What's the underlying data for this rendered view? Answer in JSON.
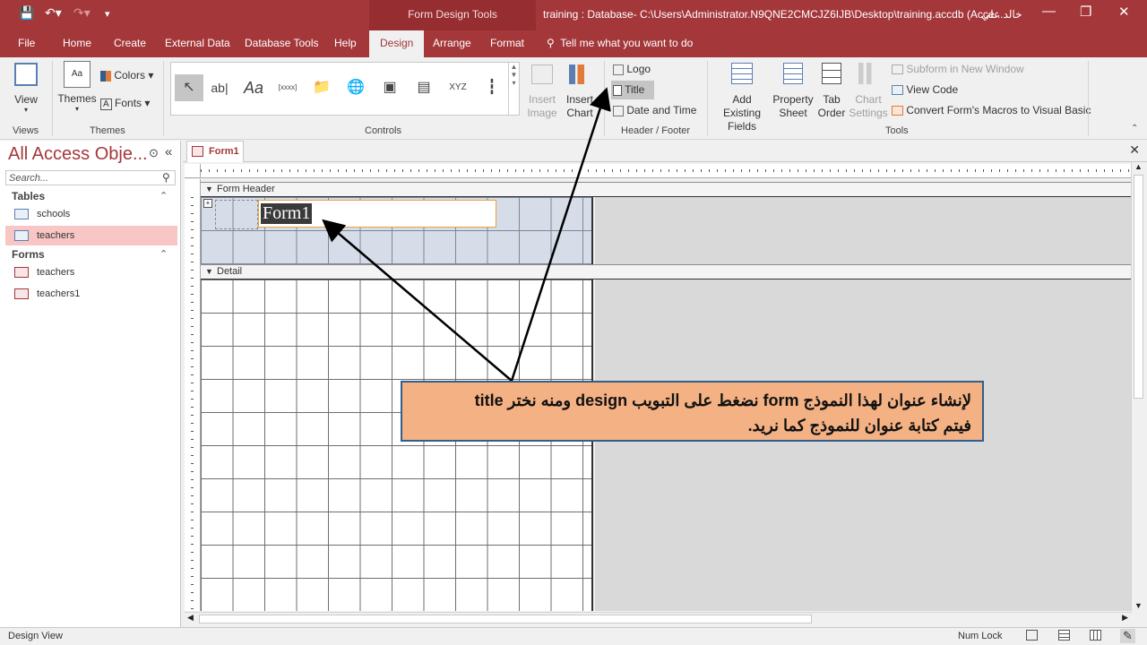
{
  "window": {
    "context_tab": "Form Design Tools",
    "title": "training : Database- C:\\Users\\Administrator.N9QNE2CMCJZ6IJB\\Desktop\\training.accdb (Acce...",
    "user": "خالد علي"
  },
  "tabs": [
    {
      "label": "File"
    },
    {
      "label": "Home"
    },
    {
      "label": "Create"
    },
    {
      "label": "External Data"
    },
    {
      "label": "Database Tools"
    },
    {
      "label": "Help"
    },
    {
      "label": "Design"
    },
    {
      "label": "Arrange"
    },
    {
      "label": "Format"
    }
  ],
  "tell_me": "Tell me what you want to do",
  "ribbon": {
    "views": {
      "label": "Views",
      "view_button": "View"
    },
    "themes": {
      "label": "Themes",
      "themes_button": "Themes",
      "colors": "Colors",
      "fonts": "Fonts"
    },
    "controls": {
      "label": "Controls",
      "insert_image": "Insert Image",
      "insert_chart": "Insert Chart"
    },
    "header_footer": {
      "label": "Header / Footer",
      "logo": "Logo",
      "title": "Title",
      "date_time": "Date and Time"
    },
    "tools": {
      "label": "Tools",
      "add_existing_fields": "Add Existing Fields",
      "property_sheet": "Property Sheet",
      "tab_order": "Tab Order",
      "chart_settings": "Chart Settings",
      "subform": "Subform in New Window",
      "view_code": "View Code",
      "convert_macros": "Convert Form's Macros to Visual Basic"
    }
  },
  "nav": {
    "title": "All Access Obje...",
    "search_placeholder": "Search...",
    "tables_header": "Tables",
    "tables": [
      "schools",
      "teachers"
    ],
    "forms_header": "Forms",
    "forms": [
      "teachers",
      "teachers1"
    ]
  },
  "document": {
    "tab": "Form1",
    "form_header_label": "Form Header",
    "detail_label": "Detail",
    "title_text": "Form1"
  },
  "callout": {
    "line1": "لإنشاء عنوان لهذا النموذج form نضغط على التبويب design ومنه نختر title",
    "line2": "فيتم كتابة عنوان للنموذج كما نريد."
  },
  "status": {
    "left": "Design View",
    "num_lock": "Num Lock"
  },
  "colors": {
    "accent": "#a4373a",
    "callout_fill": "#f4b183",
    "callout_border": "#2e5f8e"
  }
}
